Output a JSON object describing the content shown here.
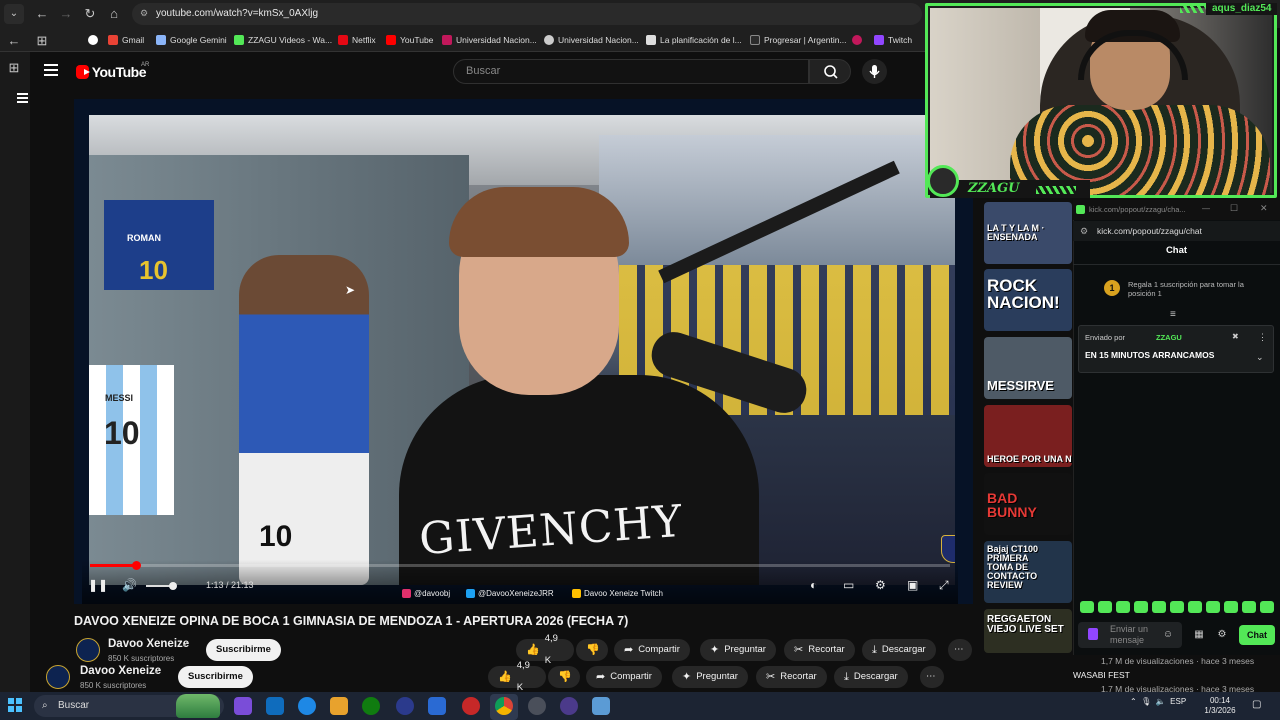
{
  "browser": {
    "url": "youtube.com/watch?v=kmSx_0AXljg",
    "bookmarks": [
      {
        "label": "Gmail",
        "color": "#ea4335"
      },
      {
        "label": "Google Gemini",
        "color": "#8ab4f8"
      },
      {
        "label": "ZZAGU Videos - Wa...",
        "color": "#53e857"
      },
      {
        "label": "Netflix",
        "color": "#e50914"
      },
      {
        "label": "YouTube",
        "color": "#ff0000"
      },
      {
        "label": "Universidad Nacion...",
        "color": "#c2185b"
      },
      {
        "label": "Universidad Nacion...",
        "color": "#cccccc"
      },
      {
        "label": "La planificación de l...",
        "color": "#dddddd"
      },
      {
        "label": "Progresar | Argentin...",
        "color": "#2b2b2b"
      },
      {
        "label": "Twitch",
        "color": "#9146ff"
      }
    ]
  },
  "youtube": {
    "logo": "YouTube",
    "country": "AR",
    "search_placeholder": "Buscar"
  },
  "player": {
    "progress": 0.053,
    "time": "1:13 / 21:13",
    "socials": [
      {
        "label": "@davoobj",
        "color": "#e1306c"
      },
      {
        "label": "@DavooXeneizeJRR",
        "color": "#1da1f2"
      },
      {
        "label": "Davoo Xeneize Twitch",
        "color": "#ffbf00"
      }
    ],
    "jersey_numbers": [
      "10",
      "10",
      "10"
    ],
    "jersey_names": [
      "ROMAN",
      "MESSI"
    ],
    "shirt_text": "GIVENCHY"
  },
  "video": {
    "title": "DAVOO XENEIZE OPINA DE BOCA 1 GIMNASIA DE MENDOZA 1 - APERTURA 2026 (FECHA 7)",
    "channel": "Davoo Xeneize",
    "subscribers": "850 K suscriptores",
    "subscribe_label": "Suscribirme",
    "likes": "4,9 K",
    "share": "Compartir",
    "ask": "Preguntar",
    "clip": "Recortar",
    "download": "Descargar"
  },
  "webcam": {
    "user": "aqus_diaz54",
    "brand": "ZZAGU"
  },
  "related": {
    "thumbs": [
      {
        "text": "LA T Y LA M · ENSENADA",
        "bg": "#3a4a6a"
      },
      {
        "text": "ROCK NACION!",
        "bg": "#2a3d5c"
      },
      {
        "text": "MESSIRVE",
        "bg": "#4e5a66"
      },
      {
        "text": "HEROE POR UNA N",
        "bg": "#7a1f1f"
      },
      {
        "text": "BAD BUNNY",
        "bg": "#111111"
      },
      {
        "text": "Bajaj CT100 PRIMERA TOMA DE CONTACTO REVIEW",
        "bg": "#22344a"
      },
      {
        "text": "REGGAETON VIEJO LIVE SET",
        "bg": "#2d2f22"
      }
    ],
    "meta1": "1,7 M de visualizaciones · hace 3 meses",
    "title2": "WASABI FEST",
    "meta2": "1,7 M de visualizaciones · hace 3 meses"
  },
  "chat": {
    "window_title": "kick.com/popout/zzagu/cha...",
    "url": "kick.com/popout/zzagu/chat",
    "header": "Chat",
    "gift_count": "1",
    "gift_text": "Regala 1 suscripción para tomar la posición 1",
    "pinned_by": "Enviado por",
    "pinned_user": "ZZAGU",
    "pinned_message": "EN 15 MINUTOS ARRANCAMOS",
    "input_placeholder": "Enviar un mensaje",
    "send_label": "Chat",
    "accent": "#53e857"
  },
  "taskbar": {
    "search": "Buscar",
    "lang": "ESP",
    "time": "00:14",
    "date": "1/3/2026"
  }
}
